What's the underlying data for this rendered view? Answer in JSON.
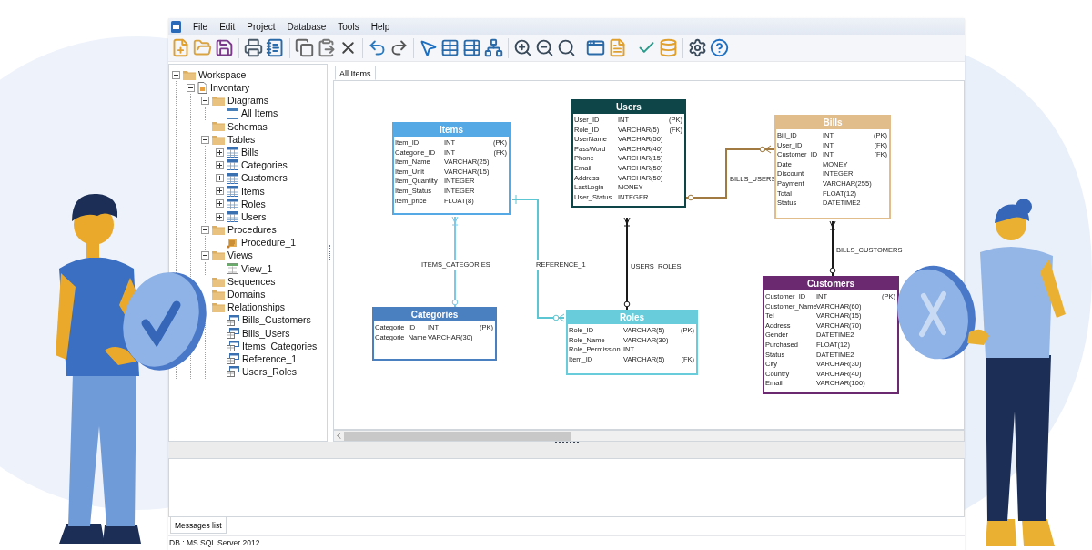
{
  "menu": [
    "File",
    "Edit",
    "Project",
    "Database",
    "Tools",
    "Help"
  ],
  "tree": [
    {
      "label": "Workspace",
      "kind": "folder",
      "expanded": true,
      "children": [
        {
          "label": "Invontary",
          "kind": "project",
          "expanded": true,
          "children": [
            {
              "label": "Diagrams",
              "kind": "folder",
              "expanded": true,
              "children": [
                {
                  "label": "All Items",
                  "kind": "diagram"
                }
              ]
            },
            {
              "label": "Schemas",
              "kind": "folder"
            },
            {
              "label": "Tables",
              "kind": "folder",
              "expanded": true,
              "children": [
                {
                  "label": "Bills",
                  "kind": "table",
                  "expanded": false
                },
                {
                  "label": "Categories",
                  "kind": "table",
                  "expanded": false
                },
                {
                  "label": "Customers",
                  "kind": "table",
                  "expanded": false
                },
                {
                  "label": "Items",
                  "kind": "table",
                  "expanded": false
                },
                {
                  "label": "Roles",
                  "kind": "table",
                  "expanded": false
                },
                {
                  "label": "Users",
                  "kind": "table",
                  "expanded": false
                }
              ]
            },
            {
              "label": "Procedures",
              "kind": "folder",
              "expanded": true,
              "children": [
                {
                  "label": "Procedure_1",
                  "kind": "procedure"
                }
              ]
            },
            {
              "label": "Views",
              "kind": "folder",
              "expanded": true,
              "children": [
                {
                  "label": "View_1",
                  "kind": "view"
                }
              ]
            },
            {
              "label": "Sequences",
              "kind": "folder"
            },
            {
              "label": "Domains",
              "kind": "folder"
            },
            {
              "label": "Relationships",
              "kind": "folder",
              "children": [
                {
                  "label": "Bills_Customers",
                  "kind": "relationship"
                },
                {
                  "label": "Bills_Users",
                  "kind": "relationship"
                },
                {
                  "label": "Items_Categories",
                  "kind": "relationship"
                },
                {
                  "label": "Reference_1",
                  "kind": "relationship"
                },
                {
                  "label": "Users_Roles",
                  "kind": "relationship"
                }
              ]
            }
          ]
        }
      ]
    }
  ],
  "tabs": [
    {
      "label": "All Items",
      "selected": true
    }
  ],
  "tables": [
    {
      "name": "Items",
      "color": "#55aae6",
      "columns": [
        {
          "name": "Item_ID",
          "type": "INT",
          "key": "(PK)"
        },
        {
          "name": "Categorie_ID",
          "type": "INT",
          "key": "(FK)"
        },
        {
          "name": "Item_Name",
          "type": "VARCHAR(25)"
        },
        {
          "name": "Item_Unit",
          "type": "VARCHAR(15)"
        },
        {
          "name": "Item_Quantity",
          "type": "INTEGER"
        },
        {
          "name": "Item_Status",
          "type": "INTEGER"
        },
        {
          "name": "item_price",
          "type": "FLOAT(8)"
        }
      ]
    },
    {
      "name": "Users",
      "color": "#0d4548",
      "columns": [
        {
          "name": "User_ID",
          "type": "INT",
          "key": "(PK)"
        },
        {
          "name": "Role_ID",
          "type": "VARCHAR(5)",
          "key": "(FK)"
        },
        {
          "name": "UserName",
          "type": "VARCHAR(50)"
        },
        {
          "name": "PassWord",
          "type": "VARCHAR(40)"
        },
        {
          "name": "Phone",
          "type": "VARCHAR(15)"
        },
        {
          "name": "Email",
          "type": "VARCHAR(50)"
        },
        {
          "name": "Address",
          "type": "VARCHAR(50)"
        },
        {
          "name": "LastLogin",
          "type": "MONEY"
        },
        {
          "name": "User_Status",
          "type": "INTEGER"
        }
      ]
    },
    {
      "name": "Bills",
      "color": "#e2bd8c",
      "columns": [
        {
          "name": "Bill_ID",
          "type": "INT",
          "key": "(PK)"
        },
        {
          "name": "User_ID",
          "type": "INT",
          "key": "(FK)"
        },
        {
          "name": "Customer_ID",
          "type": "INT",
          "key": "(FK)"
        },
        {
          "name": "Date",
          "type": "MONEY"
        },
        {
          "name": "Discount",
          "type": "INTEGER"
        },
        {
          "name": "Payment",
          "type": "VARCHAR(255)"
        },
        {
          "name": "Total",
          "type": "FLOAT(12)"
        },
        {
          "name": "Status",
          "type": "DATETIME2"
        }
      ]
    },
    {
      "name": "Customers",
      "color": "#6b2a70",
      "columns": [
        {
          "name": "Customer_ID",
          "type": "INT",
          "key": "(PK)"
        },
        {
          "name": "Customer_Name",
          "type": "VARCHAR(60)"
        },
        {
          "name": "Tel",
          "type": "VARCHAR(15)"
        },
        {
          "name": "Address",
          "type": "VARCHAR(70)"
        },
        {
          "name": "Gender",
          "type": "DATETIME2"
        },
        {
          "name": "Purchased",
          "type": "FLOAT(12)"
        },
        {
          "name": "Status",
          "type": "DATETIME2"
        },
        {
          "name": "City",
          "type": "VARCHAR(30)"
        },
        {
          "name": "Country",
          "type": "VARCHAR(40)"
        },
        {
          "name": "Email",
          "type": "VARCHAR(100)"
        }
      ]
    },
    {
      "name": "Categories",
      "color": "#4a7fc0",
      "columns": [
        {
          "name": "Categorie_ID",
          "type": "INT",
          "key": "(PK)"
        },
        {
          "name": "Categorie_Name",
          "type": "VARCHAR(30)"
        }
      ]
    },
    {
      "name": "Roles",
      "color": "#68ccda",
      "columns": [
        {
          "name": "Role_ID",
          "type": "VARCHAR(5)",
          "key": "(PK)"
        },
        {
          "name": "Role_Name",
          "type": "VARCHAR(30)"
        },
        {
          "name": "Role_Permission",
          "type": "INT"
        },
        {
          "name": "Item_ID",
          "type": "VARCHAR(5)",
          "key": "(FK)"
        }
      ]
    }
  ],
  "relationships": [
    {
      "label": "ITEMS_CATEGORIES",
      "color": "#7cc8e6"
    },
    {
      "label": "REFERENCE_1",
      "color": "#5cc6d2"
    },
    {
      "label": "USERS_ROLES",
      "color": "#1a1a1a"
    },
    {
      "label": "BILLS_USERS",
      "color": "#a07a40"
    },
    {
      "label": "BILLS_CUSTOMERS",
      "color": "#1a1a1a"
    }
  ],
  "bottom_tabs": [
    {
      "label": "Messages list",
      "selected": true
    }
  ],
  "status_bar": "DB : MS SQL Server 2012"
}
